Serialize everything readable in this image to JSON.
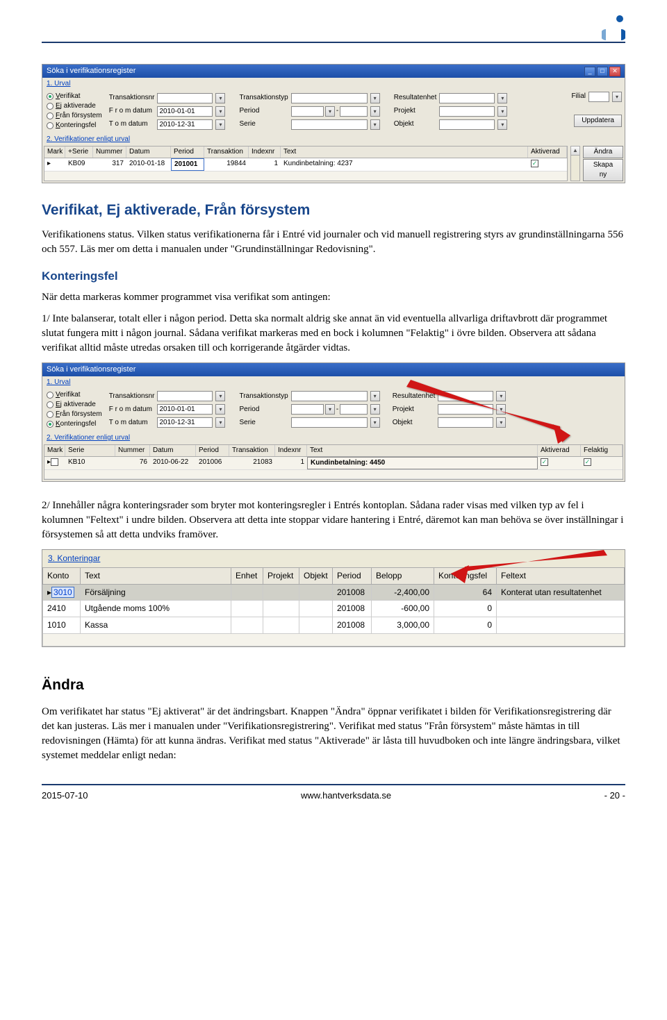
{
  "logo_colors": {
    "top": "#1058a8",
    "left": "#7aa8d4",
    "right": "#1058a8"
  },
  "screenshot1": {
    "title": "Söka i verifikationsregister",
    "section1": "1. Urval",
    "radios": [
      {
        "label": "Verifikat",
        "accel": "V",
        "selected": true
      },
      {
        "label": "Ej aktiverade",
        "accel": "E",
        "selected": false
      },
      {
        "label": "Från försystem",
        "accel": "F",
        "selected": false
      },
      {
        "label": "Konteringsfel",
        "accel": "K",
        "selected": false
      }
    ],
    "fields": {
      "transaktionsnr": "Transaktionsnr",
      "from_datum": "F r o m  datum",
      "from_datum_val": "2010-01-01",
      "tom_datum": "T o m datum",
      "tom_datum_val": "2010-12-31",
      "transaktionstyp": "Transaktionstyp",
      "period": "Period",
      "serie": "Serie",
      "resultatenhet": "Resultatenhet",
      "projekt": "Projekt",
      "objekt": "Objekt",
      "filial": "Filial",
      "uppdatera": "Uppdatera"
    },
    "section2": "2. Verifikationer enligt urval",
    "table": {
      "headers": [
        "Mark",
        "+Serie",
        "Nummer",
        "Datum",
        "Period",
        "Transaktion",
        "Indexnr",
        "Text",
        "Aktiverad"
      ],
      "row": {
        "mark": "",
        "serie": "KB09",
        "nummer": "317",
        "datum": "2010-01-18",
        "period": "201001",
        "transaktion": "19844",
        "indexnr": "1",
        "text": "Kundinbetalning: 4237",
        "aktiverad": true
      }
    },
    "side": {
      "andra": "Ändra",
      "skapa": "Skapa ny"
    }
  },
  "heading1": "Verifikat, Ej aktiverade, Från försystem",
  "para1": "Verifikationens status. Vilken status verifikationerna får i Entré vid journaler och vid manuell registrering styrs av grundinställningarna 556 och 557. Läs mer om detta i manualen under \"Grundinställningar Redovisning\".",
  "heading2": "Konteringsfel",
  "para2": "När detta markeras kommer programmet visa verifikat som antingen:",
  "para3": "1/ Inte balanserar, totalt eller i någon period. Detta ska normalt aldrig ske annat än vid eventuella allvarliga driftavbrott där programmet slutat fungera mitt i någon journal. Sådana verifikat markeras med en bock i kolumnen \"Felaktig\" i övre bilden. Observera att sådana verifikat alltid måste utredas orsaken till och korrigerande åtgärder vidtas.",
  "screenshot2": {
    "title": "Söka i verifikationsregister",
    "section1": "1. Urval",
    "radios": [
      {
        "label": "Verifikat",
        "accel": "V",
        "selected": false
      },
      {
        "label": "Ej aktiverade",
        "accel": "E",
        "selected": false
      },
      {
        "label": "Från försystem",
        "accel": "F",
        "selected": false
      },
      {
        "label": "Konteringsfel",
        "accel": "K",
        "selected": true
      }
    ],
    "fields": {
      "transaktionsnr": "Transaktionsnr",
      "from_datum": "F r o m  datum",
      "from_datum_val": "2010-01-01",
      "tom_datum": "T o m datum",
      "tom_datum_val": "2010-12-31",
      "transaktionstyp": "Transaktionstyp",
      "period": "Period",
      "serie": "Serie",
      "resultatenhet": "Resultatenhet",
      "projekt": "Projekt",
      "objekt": "Objekt"
    },
    "section2": "2. Verifikationer enligt urval",
    "table": {
      "headers": [
        "Mark",
        "Serie",
        "Nummer",
        "Datum",
        "Period",
        "Transaktion",
        "Indexnr",
        "Text",
        "Aktiverad",
        "Felaktig"
      ],
      "row": {
        "mark": "",
        "serie": "KB10",
        "nummer": "76",
        "datum": "2010-06-22",
        "period": "201006",
        "transaktion": "21083",
        "indexnr": "1",
        "text": "Kundinbetalning: 4450",
        "aktiverad": true,
        "felaktig": true
      }
    }
  },
  "para4": "2/ Innehåller några konteringsrader som bryter mot konteringsregler i Entrés kontoplan. Sådana rader visas med vilken typ av fel i kolumnen \"Feltext\" i undre bilden. Observera att detta inte stoppar vidare hantering i Entré, däremot kan man behöva se över inställningar i försystemen så att detta undviks framöver.",
  "screenshot3": {
    "section": "3. Konteringar",
    "headers": [
      "Konto",
      "Text",
      "Enhet",
      "Projekt",
      "Objekt",
      "Period",
      "Belopp",
      "Konteringsfel",
      "Feltext"
    ],
    "rows": [
      {
        "konto": "3010",
        "text": "Försäljning",
        "period": "201008",
        "belopp": "-2,400,00",
        "konteringsfel": "64",
        "feltext": "Konterat utan resultatenhet",
        "sel": true
      },
      {
        "konto": "2410",
        "text": "Utgående moms 100%",
        "period": "201008",
        "belopp": "-600,00",
        "konteringsfel": "0",
        "feltext": "",
        "sel": false
      },
      {
        "konto": "1010",
        "text": "Kassa",
        "period": "201008",
        "belopp": "3,000,00",
        "konteringsfel": "0",
        "feltext": "",
        "sel": false
      }
    ]
  },
  "heading3": "Ändra",
  "para5": "Om verifikatet har status \"Ej aktiverat\" är det ändringsbart. Knappen \"Ändra\" öppnar verifikatet i bilden för Verifikationsregistrering där det kan justeras. Läs mer i manualen under \"Verifikationsregistrering\". Verifikat med status \"Från försystem\" måste hämtas in till redovisningen (Hämta) för att kunna ändras. Verifikat med status \"Aktiverade\" är låsta till huvudboken och inte längre ändringsbara, vilket systemet meddelar enligt nedan:",
  "footer": {
    "date": "2015-07-10",
    "url": "www.hantverksdata.se",
    "page": "- 20 -"
  }
}
